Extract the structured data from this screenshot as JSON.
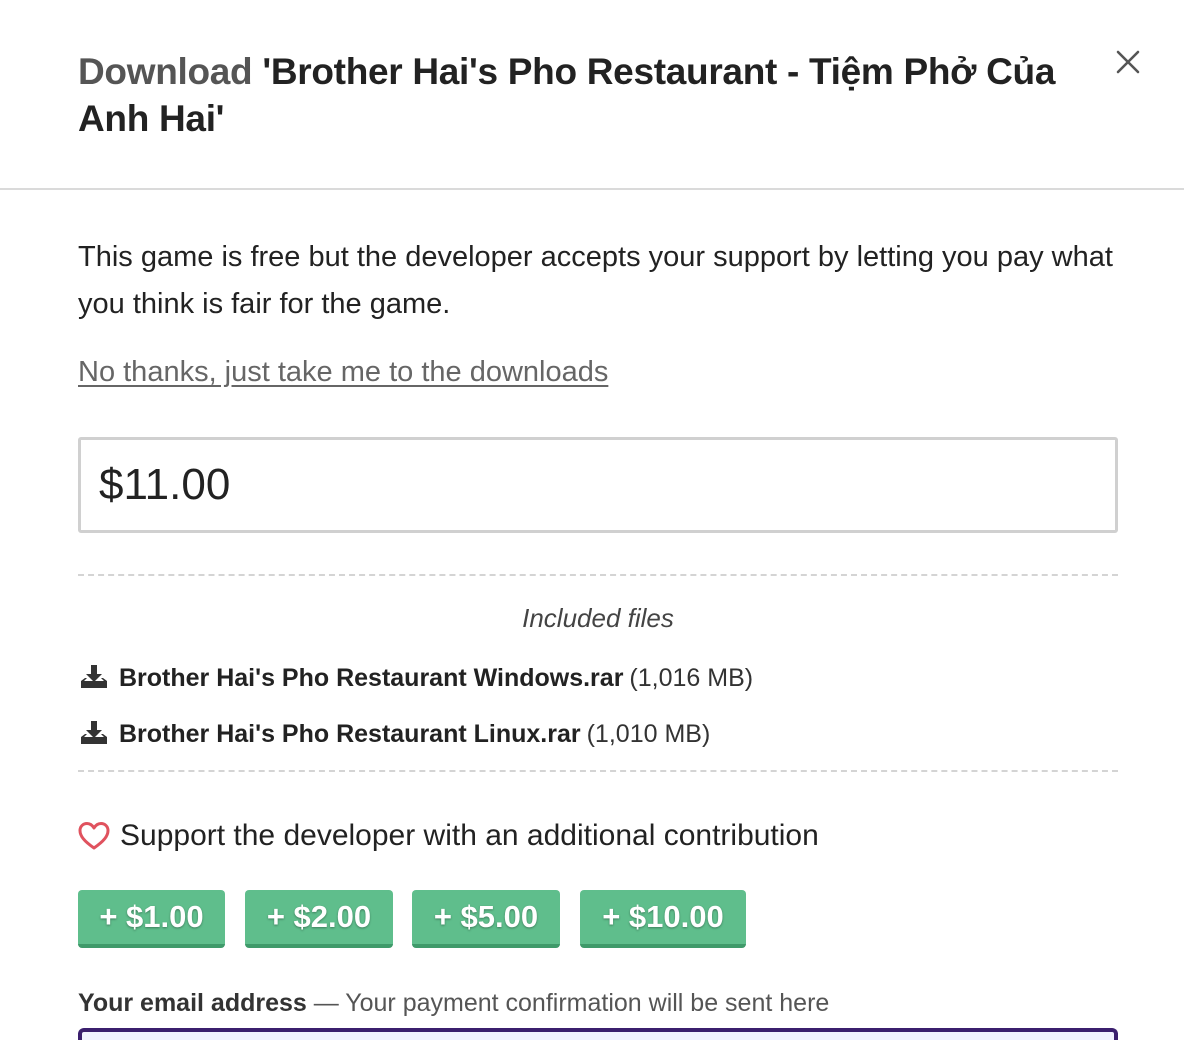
{
  "dialog": {
    "title_prefix": "Download",
    "title_game": "'Brother Hai's Pho Restaurant - Tiệm Phở Của Anh Hai'",
    "close_icon": "close-icon"
  },
  "intro": {
    "text": "This game is free but the developer accepts your support by letting you pay what you think is fair for the game.",
    "skip_link": "No thanks, just take me to the downloads"
  },
  "price": {
    "value": "$11.00"
  },
  "files": {
    "heading": "Included files",
    "items": [
      {
        "name": "Brother Hai's Pho Restaurant Windows.rar",
        "size": "(1,016 MB)",
        "icon": "download-icon"
      },
      {
        "name": "Brother Hai's Pho Restaurant Linux.rar",
        "size": "(1,010 MB)",
        "icon": "download-icon"
      }
    ]
  },
  "support": {
    "text": "Support the developer with an additional contribution",
    "icon": "heart-icon",
    "tips": [
      "+ $1.00",
      "+ $2.00",
      "+ $5.00",
      "+ $10.00"
    ]
  },
  "email": {
    "label": "Your email address",
    "hint": " — Your payment confirmation will be sent here",
    "value": ""
  },
  "colors": {
    "tip_button": "#5fbe8c",
    "tip_button_shadow": "#3f9a6a",
    "heart": "#e0525e",
    "email_border": "#3b1f6e"
  }
}
